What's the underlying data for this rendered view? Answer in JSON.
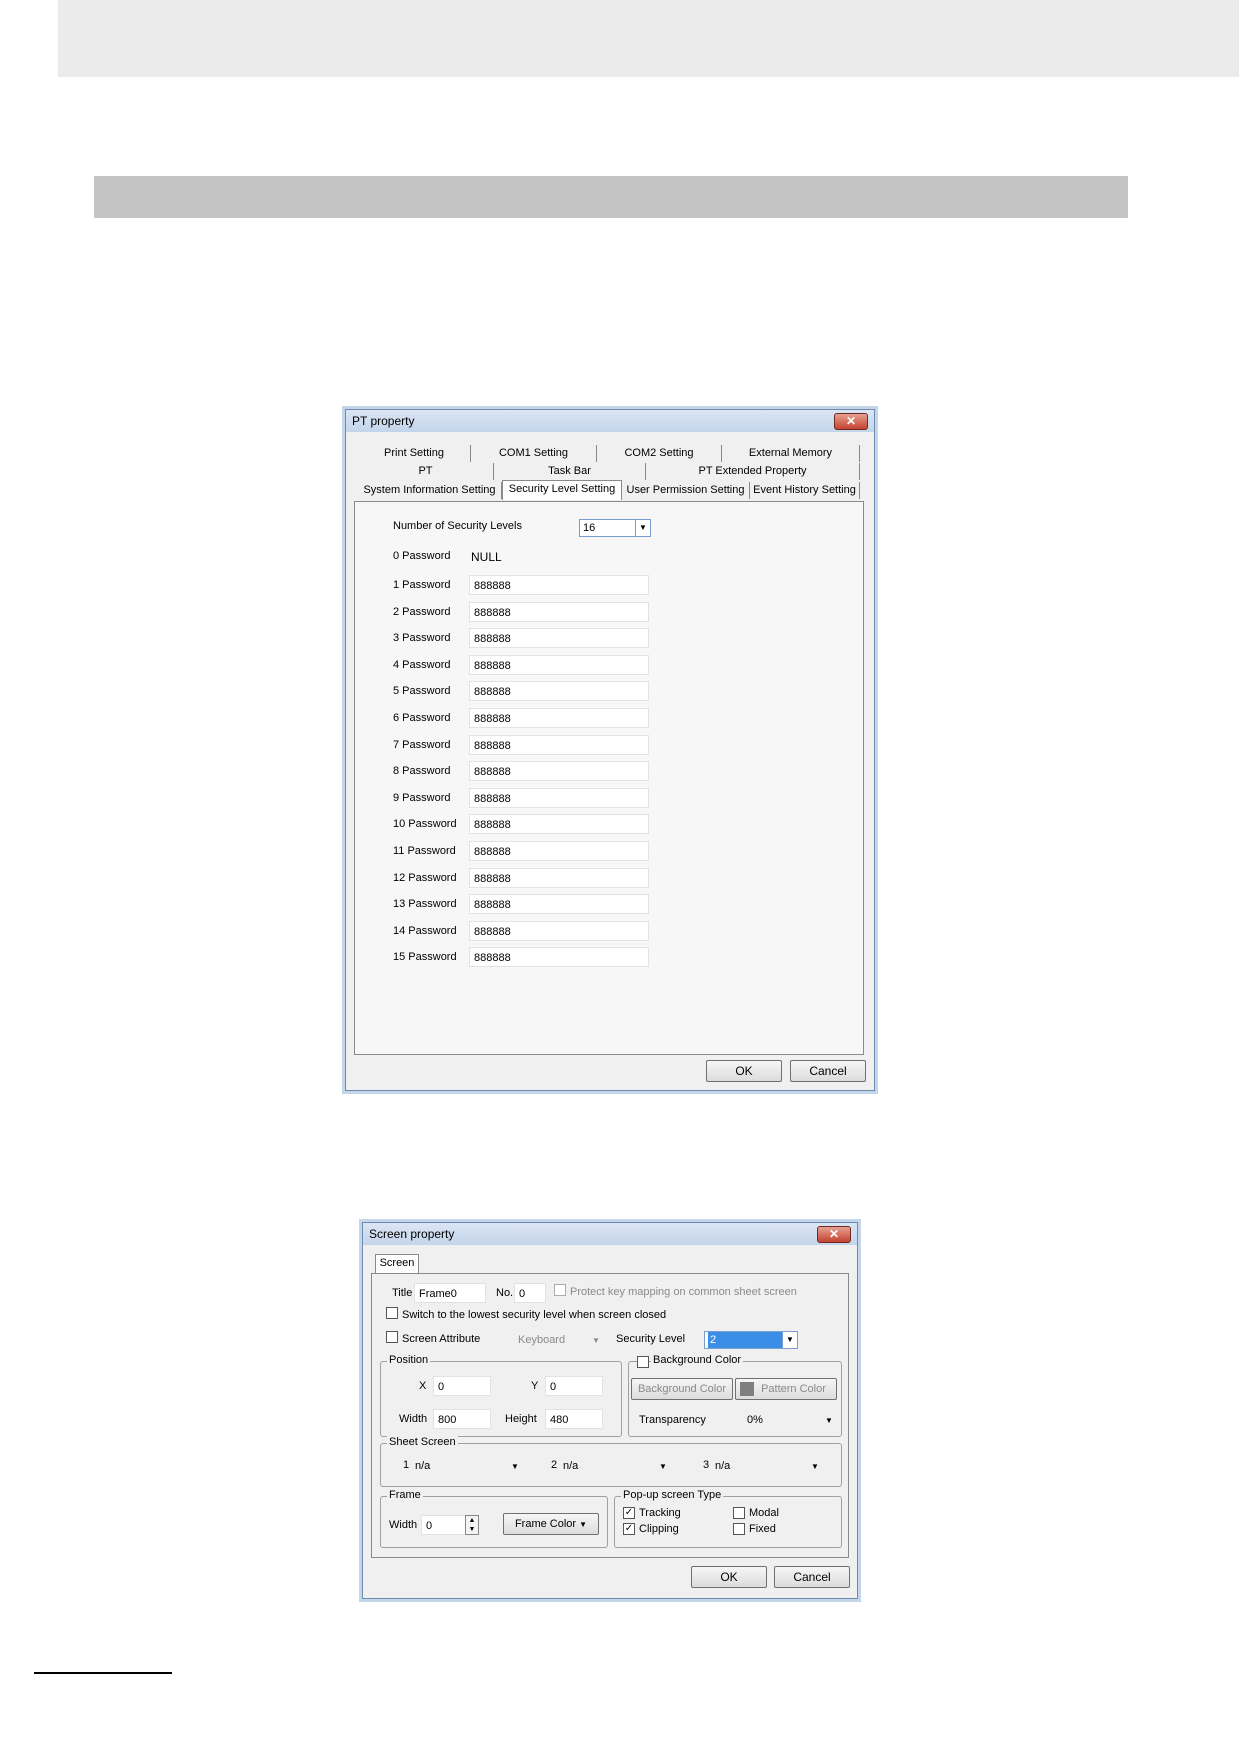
{
  "pt": {
    "title": "PT property",
    "close": "✕",
    "tabs_row1": [
      "Print Setting",
      "COM1 Setting",
      "COM2 Setting",
      "External Memory"
    ],
    "tabs_row2": [
      "PT",
      "Task Bar",
      "PT Extended Property"
    ],
    "tabs_row3": [
      "System Information Setting",
      "Security Level Setting",
      "User Permission Setting",
      "Event History Setting"
    ],
    "active_tab": "Security Level Setting",
    "levels_label": "Number of Security Levels",
    "levels_value": "16",
    "pw0_label": "0 Password",
    "pw0_value": "NULL",
    "passwords": [
      {
        "label": "1 Password",
        "value": "888888"
      },
      {
        "label": "2 Password",
        "value": "888888"
      },
      {
        "label": "3 Password",
        "value": "888888"
      },
      {
        "label": "4 Password",
        "value": "888888"
      },
      {
        "label": "5 Password",
        "value": "888888"
      },
      {
        "label": "6 Password",
        "value": "888888"
      },
      {
        "label": "7 Password",
        "value": "888888"
      },
      {
        "label": "8 Password",
        "value": "888888"
      },
      {
        "label": "9 Password",
        "value": "888888"
      },
      {
        "label": "10 Password",
        "value": "888888"
      },
      {
        "label": "11 Password",
        "value": "888888"
      },
      {
        "label": "12 Password",
        "value": "888888"
      },
      {
        "label": "13 Password",
        "value": "888888"
      },
      {
        "label": "14 Password",
        "value": "888888"
      },
      {
        "label": "15 Password",
        "value": "888888"
      }
    ],
    "ok": "OK",
    "cancel": "Cancel"
  },
  "screen": {
    "title": "Screen property",
    "close": "✕",
    "tab": "Screen",
    "title_label": "Title",
    "title_value": "Frame0",
    "no_label": "No.",
    "no_value": "0",
    "protect_label": "Protect key mapping on common sheet screen",
    "switch_label": "Switch to the lowest security level when screen closed",
    "attr_label": "Screen Attribute",
    "attr_value": "Keyboard",
    "sec_label": "Security Level",
    "sec_value": "2",
    "position_caption": "Position",
    "x_label": "X",
    "x_value": "0",
    "y_label": "Y",
    "y_value": "0",
    "width_label": "Width",
    "width_value": "800",
    "height_label": "Height",
    "height_value": "480",
    "bg_caption": "Background Color",
    "bg_button": "Background Color",
    "pattern_button": "Pattern Color",
    "transparency_label": "Transparency",
    "transparency_value": "0%",
    "sheet_caption": "Sheet Screen",
    "sheets": [
      {
        "n": "1",
        "v": "n/a"
      },
      {
        "n": "2",
        "v": "n/a"
      },
      {
        "n": "3",
        "v": "n/a"
      }
    ],
    "frame_caption": "Frame",
    "frame_width_label": "Width",
    "frame_width_value": "0",
    "frame_color": "Frame Color",
    "popup_caption": "Pop-up screen Type",
    "tracking": "Tracking",
    "clipping": "Clipping",
    "modal": "Modal",
    "fixed": "Fixed",
    "ok": "OK",
    "cancel": "Cancel"
  },
  "colors": {
    "accent_blue": "#3a8ee6",
    "pattern_swatch": "#7f7f7f"
  }
}
